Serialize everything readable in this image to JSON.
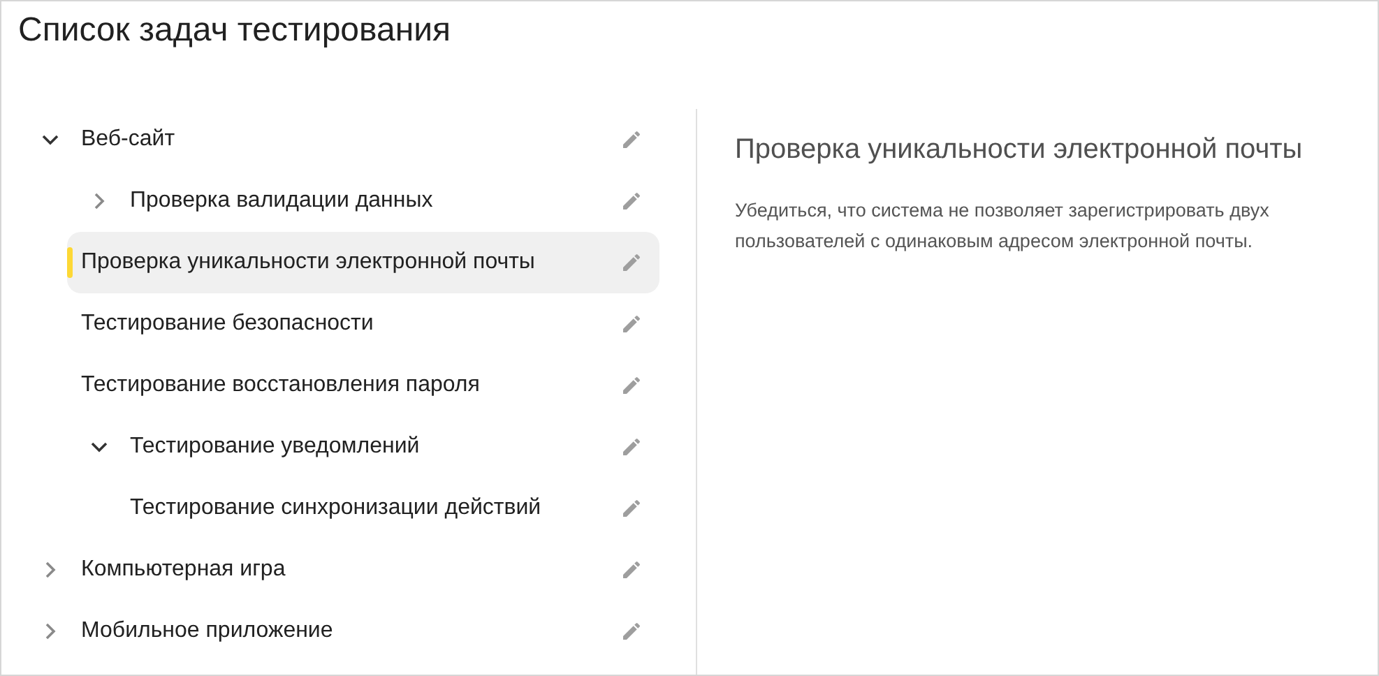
{
  "title": "Список задач тестирования",
  "tree": [
    {
      "label": "Веб-сайт",
      "expanded": true,
      "selected": false,
      "children": [
        {
          "label": "Проверка валидации данных",
          "expanded": false,
          "selected": false
        },
        {
          "label": "Проверка уникальности электронной почты",
          "selected": true
        },
        {
          "label": "Тестирование безопасности",
          "selected": false
        },
        {
          "label": "Тестирование восстановления пароля",
          "selected": false
        },
        {
          "label": "Тестирование уведомлений",
          "expanded": true,
          "selected": false,
          "children": [
            {
              "label": "Тестирование синхронизации действий",
              "selected": false
            }
          ]
        }
      ]
    },
    {
      "label": "Компьютерная игра",
      "expanded": false,
      "selected": false
    },
    {
      "label": "Мобильное приложение",
      "expanded": false,
      "selected": false
    }
  ],
  "detail": {
    "title": "Проверка уникальности электронной почты",
    "description": "Убедиться, что система не позволяет зарегистрировать двух пользователей с одинаковым адресом электронной почты."
  }
}
